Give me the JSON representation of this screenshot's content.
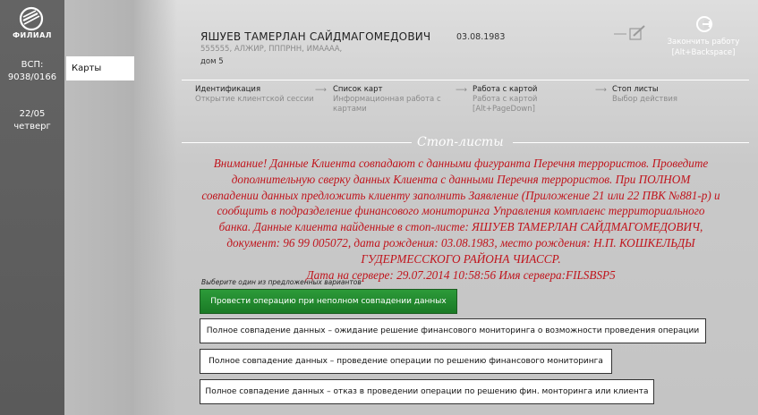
{
  "sidebar": {
    "logo_text": "ФИЛИАЛ",
    "vsp_label": "ВСП:",
    "vsp_value": "9038/0166",
    "date": "22/05",
    "weekday": "четверг"
  },
  "menu": {
    "items": [
      {
        "label": "Карты"
      }
    ]
  },
  "client": {
    "name": "ЯШУЕВ ТАМЕРЛАН САЙДМАГОМЕДОВИЧ",
    "birthdate": "03.08.1983",
    "address": "555555, АЛЖИР, ПППРНН, ИМАААА,",
    "house": "дом 5"
  },
  "actions": {
    "exit_label_1": "Закончить работу",
    "exit_label_2": "[Alt+Backspace]",
    "edit_icon": "edit-icon",
    "exit_icon": "exit-icon"
  },
  "steps": [
    {
      "title": "Идентификация",
      "sub1": "Открытие клиентской сессии",
      "sub2": "",
      "sub3": ""
    },
    {
      "title": "Список карт",
      "sub1": "Информационная работа с",
      "sub2": "картами",
      "sub3": ""
    },
    {
      "title": "Работа с картой",
      "sub1": "Работа с картой",
      "sub2": "[Alt+PageDown]",
      "sub3": ""
    },
    {
      "title": "Стоп листы",
      "sub1": "Выбор действия",
      "sub2": "",
      "sub3": ""
    }
  ],
  "stoplist": {
    "title": "Стоп-листы",
    "warning_lines": [
      "Внимание! Данные Клиента совпадают с данными фигуранта Перечня террористов. Проведите",
      "дополнительную сверку данных Клиента с данными Перечня террористов. При ПОЛНОМ",
      "совпадении данных предложить клиенту заполнить Заявление (Приложение 21 или 22 ПВК №881-р) и",
      "сообщить в подразделение финансового мониторинга Управления комплаенс территориального",
      "банка. Данные клиента найденные в стоп-листе: ЯШУЕВ ТАМЕРЛАН САЙДМАГОМЕДОВИЧ,",
      "документ: 96 99 005072, дата рождения: 03.08.1983, место рождения: Н.П. КОШКЕЛЬДЫ",
      "ГУДЕРМЕССКОГО РАЙОНА ЧИАССР.",
      "Дата на сервере: 29.07.2014 10:58:56 Имя сервера:FILSBSP5"
    ],
    "choose_label": "Выберите один из предложенных вариантов",
    "options": [
      "Провести операцию при неполном совпадении данных",
      "Полное совпадение данных – ожидание решение финансового мониторинга о возможности проведения операции",
      "Полное совпадение данных – проведение операции по решению финансового мониторинга",
      "Полное совпадение данных – отказ в проведении операции по решению фин. монторинга или клиента"
    ]
  },
  "colors": {
    "warning": "#c0141c",
    "primary_button": "#1f8a2b",
    "rail": "#5e5e5e"
  }
}
